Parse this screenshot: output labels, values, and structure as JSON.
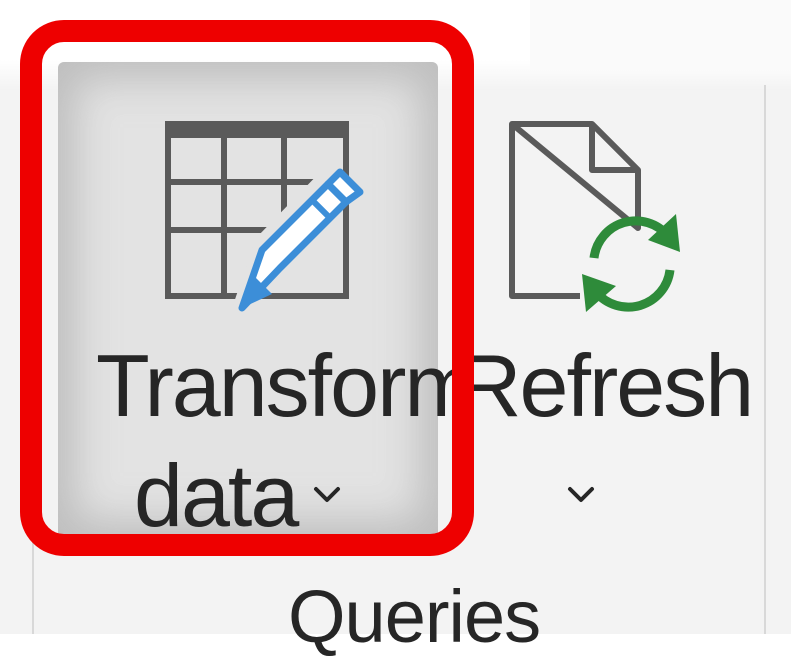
{
  "ribbon": {
    "group": {
      "label": "Queries",
      "buttons": {
        "transform_data": {
          "label_line1": "Transform",
          "label_line2": "data",
          "icon": "table-edit-icon",
          "has_dropdown": true,
          "highlighted": true
        },
        "refresh": {
          "label_line1": "Refresh",
          "icon": "refresh-document-icon",
          "has_dropdown": true
        }
      }
    }
  },
  "colors": {
    "highlight": "#ee0000",
    "text": "#262626",
    "refresh_arrows": "#2e8b3a",
    "pencil": "#3c8ed8"
  }
}
